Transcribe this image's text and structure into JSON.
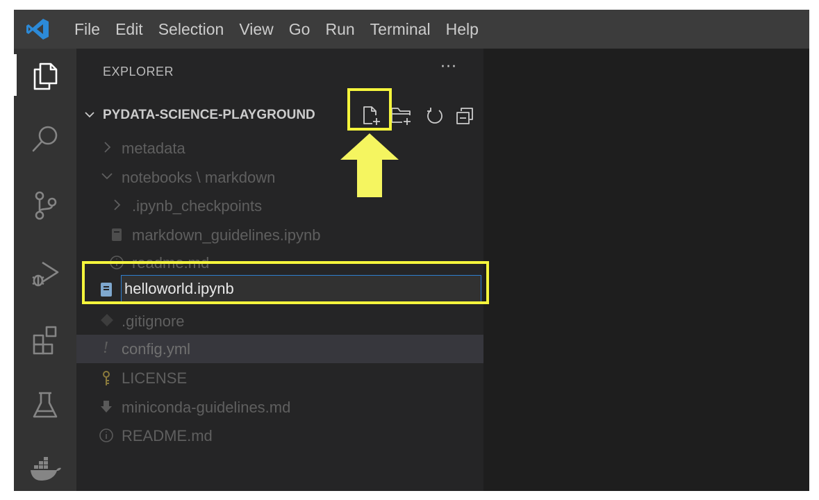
{
  "menu": {
    "items": [
      "File",
      "Edit",
      "Selection",
      "View",
      "Go",
      "Run",
      "Terminal",
      "Help"
    ]
  },
  "activity_bar": {
    "icons": [
      "explorer-icon",
      "search-icon",
      "source-control-icon",
      "run-debug-icon",
      "extensions-icon",
      "testing-icon",
      "docker-icon"
    ]
  },
  "explorer": {
    "title": "EXPLORER",
    "more": "···",
    "root": "PYDATA-SCIENCE-PLAYGROUND",
    "toolbar": [
      "new-file-icon",
      "new-folder-icon",
      "refresh-icon",
      "collapse-all-icon"
    ],
    "tree": [
      {
        "label": "metadata",
        "icon": "chevron-right-icon"
      },
      {
        "label": "notebooks \\ markdown",
        "icon": "chevron-down-icon"
      },
      {
        "label": ".ipynb_checkpoints",
        "icon": "chevron-right-icon"
      },
      {
        "label": "markdown_guidelines.ipynb",
        "icon": "notebook-icon"
      },
      {
        "label": "readme.md",
        "icon": "info-icon"
      },
      {
        "label": ".gitignore",
        "icon": "git-icon"
      },
      {
        "label": "config.yml",
        "icon": "exclamation-icon"
      },
      {
        "label": "LICENSE",
        "icon": "key-icon"
      },
      {
        "label": "miniconda-guidelines.md",
        "icon": "download-arrow-icon"
      },
      {
        "label": "README.md",
        "icon": "info-icon"
      }
    ],
    "rename_value": "helloworld.ipynb"
  },
  "colors": {
    "highlight": "#f5f53c",
    "rename_border": "#2f7fd0",
    "selection": "#37373d"
  }
}
